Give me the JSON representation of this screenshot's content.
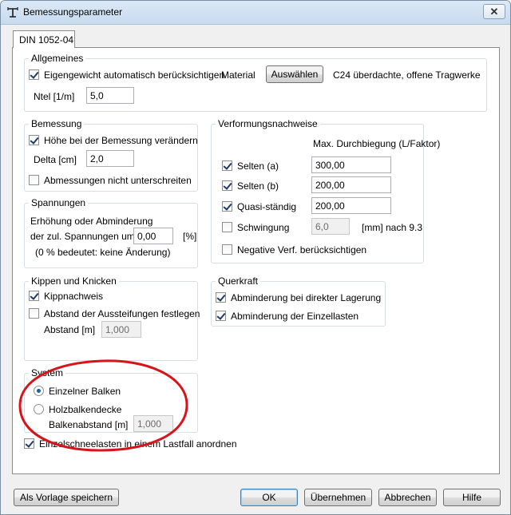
{
  "window": {
    "title": "Bemessungsparameter",
    "close_glyph": "✕"
  },
  "tabs": [
    {
      "label": "DIN 1052-04",
      "active": true
    }
  ],
  "allgemeines": {
    "title": "Allgemeines",
    "eigengewicht_label": "Eigengewicht automatisch berücksichtigen",
    "eigengewicht_checked": true,
    "material_label": "Material",
    "auswaehlen_label": "Auswählen",
    "material_value": "C24 überdachte, offene Tragwerke",
    "ntel_label": "Ntel [1/m]",
    "ntel_value": "5,0"
  },
  "bemessung": {
    "title": "Bemessung",
    "hoehe_label": "Höhe bei der Bemessung verändern",
    "hoehe_checked": true,
    "delta_label": "Delta [cm]",
    "delta_value": "2,0",
    "abmessungen_label": "Abmessungen nicht unterschreiten",
    "abmessungen_checked": false
  },
  "spannungen": {
    "title": "Spannungen",
    "line1": "Erhöhung oder Abminderung",
    "line2": "der zul. Spannungen um:",
    "value": "0,00",
    "unit": "[%]",
    "note": "(0 % bedeutet: keine Änderung)"
  },
  "kippen": {
    "title": "Kippen und Knicken",
    "kippnachweis_label": "Kippnachweis",
    "kippnachweis_checked": true,
    "abstand_aussteifung_label": "Abstand der Aussteifungen festlegen",
    "abstand_aussteifung_checked": false,
    "abstand_label": "Abstand [m]",
    "abstand_value": "1,000"
  },
  "system": {
    "title": "System",
    "einzelner_label": "Einzelner Balken",
    "holzbalken_label": "Holzbalkendecke",
    "selected": "einzelner",
    "balkenabstand_label": "Balkenabstand [m]",
    "balkenabstand_value": "1,000"
  },
  "einzelschnee": {
    "label": "Einzelschneelasten in einem Lastfall anordnen",
    "checked": true
  },
  "verformung": {
    "title": "Verformungsnachweise",
    "header": "Max. Durchbiegung (L/Faktor)",
    "selten_a_label": "Selten (a)",
    "selten_a_value": "300,00",
    "selten_a_checked": true,
    "selten_b_label": "Selten (b)",
    "selten_b_value": "200,00",
    "selten_b_checked": true,
    "quasi_label": "Quasi-ständig",
    "quasi_value": "200,00",
    "quasi_checked": true,
    "schwingung_label": "Schwingung",
    "schwingung_value": "6,0",
    "schwingung_checked": false,
    "schwingung_unit": "[mm] nach 9.3",
    "negative_label": "Negative Verf. berücksichtigen",
    "negative_checked": false
  },
  "querkraft": {
    "title": "Querkraft",
    "lagerung_label": "Abminderung bei direkter Lagerung",
    "lagerung_checked": true,
    "einzellasten_label": "Abminderung der Einzellasten",
    "einzellasten_checked": true
  },
  "buttons": {
    "vorlage": "Als Vorlage speichern",
    "ok": "OK",
    "uebernehmen": "Übernehmen",
    "abbrechen": "Abbrechen",
    "hilfe": "Hilfe"
  },
  "colors": {
    "annotation": "#d8141b",
    "accent": "#3c7fb1"
  }
}
